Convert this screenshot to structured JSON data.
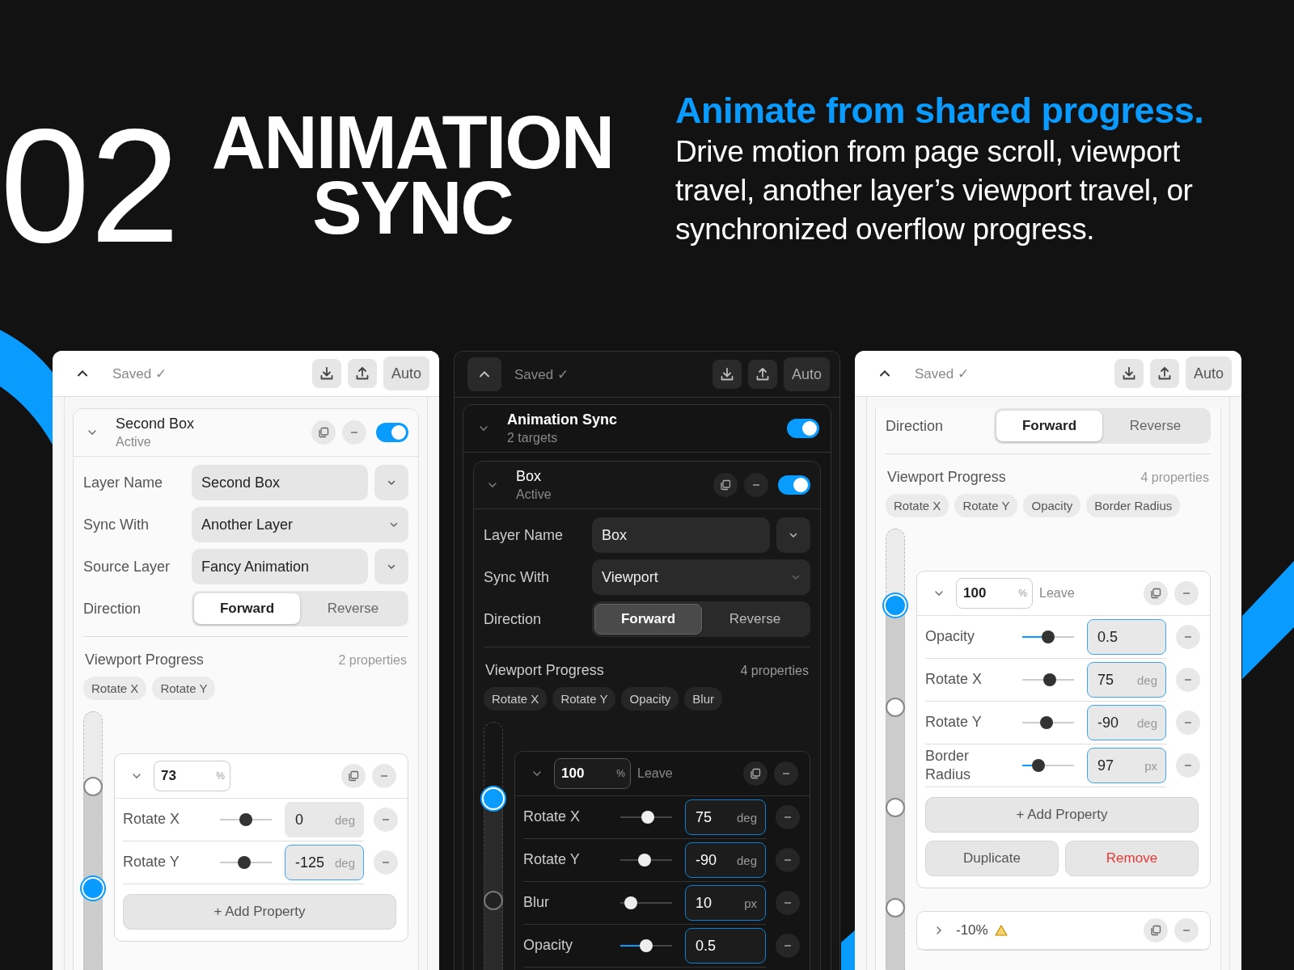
{
  "hero": {
    "number": "02",
    "title_lines": [
      "ANIMATION",
      "SYNC"
    ],
    "headline": "Animate from shared progress.",
    "description": "Drive motion from page scroll, viewport travel, another layer’s viewport travel, or synchronized overflow progress."
  },
  "panels": [
    {
      "dark": false,
      "header": {
        "status": "Saved ✓",
        "mode_button": "Auto"
      },
      "layer": {
        "title": "Second Box",
        "subtitle": "Active",
        "on": true,
        "fields": [
          {
            "label": "Layer Name",
            "value": "Second Box",
            "kind": "split"
          },
          {
            "label": "Sync With",
            "value": "Another Layer",
            "kind": "inline"
          },
          {
            "label": "Source Layer",
            "value": "Fancy Animation",
            "kind": "split"
          }
        ],
        "direction": {
          "label": "Direction",
          "options": [
            {
              "label": "Forward",
              "selected": true
            },
            {
              "label": "Reverse",
              "selected": false
            }
          ]
        },
        "progress": {
          "title": "Viewport Progress",
          "count": "2 properties",
          "chips": [
            "Rotate X",
            "Rotate Y"
          ]
        },
        "stops": [
          {
            "selected": false
          },
          {
            "selected": true
          }
        ],
        "keyframes": [
          {
            "value": "73",
            "unit": "%",
            "expanded": true,
            "rows": [
              {
                "label": "Rotate X",
                "level": 0.5,
                "filled": false,
                "value": "0",
                "unit": "deg",
                "focused": false
              },
              {
                "label": "Rotate Y",
                "level": 0.45,
                "filled": false,
                "value": "-125",
                "unit": "deg",
                "focused": true
              }
            ],
            "add_button": "+ Add Property"
          }
        ]
      }
    },
    {
      "dark": true,
      "header": {
        "status": "Saved ✓",
        "mode_button": "Auto"
      },
      "group": {
        "title": "Animation Sync",
        "subtitle": "2 targets",
        "on": true
      },
      "layer": {
        "title": "Box",
        "subtitle": "Active",
        "on": true,
        "fields": [
          {
            "label": "Layer Name",
            "value": "Box",
            "kind": "split"
          },
          {
            "label": "Sync With",
            "value": "Viewport",
            "kind": "inline"
          }
        ],
        "direction": {
          "label": "Direction",
          "options": [
            {
              "label": "Forward",
              "selected": true
            },
            {
              "label": "Reverse",
              "selected": false
            }
          ]
        },
        "progress": {
          "title": "Viewport Progress",
          "count": "4 properties",
          "chips": [
            "Rotate X",
            "Rotate Y",
            "Opacity",
            "Blur"
          ]
        },
        "stops": [
          {
            "selected": true
          },
          {
            "selected": false
          }
        ],
        "keyframes": [
          {
            "value": "100",
            "unit": "%",
            "tag": "Leave",
            "expanded": true,
            "rows": [
              {
                "label": "Rotate X",
                "level": 0.55,
                "filled": false,
                "value": "75",
                "unit": "deg",
                "focused": true
              },
              {
                "label": "Rotate Y",
                "level": 0.45,
                "filled": false,
                "value": "-90",
                "unit": "deg",
                "focused": true
              },
              {
                "label": "Blur",
                "level": 0.1,
                "filled": false,
                "value": "10",
                "unit": "px",
                "focused": true
              },
              {
                "label": "Opacity",
                "level": 0.5,
                "filled": true,
                "value": "0.5",
                "focused": true
              }
            ]
          }
        ]
      }
    },
    {
      "dark": false,
      "header": {
        "status": "Saved ✓",
        "mode_button": "Auto"
      },
      "layer": {
        "direction": {
          "label": "Direction",
          "options": [
            {
              "label": "Forward",
              "selected": true
            },
            {
              "label": "Reverse",
              "selected": false
            }
          ]
        },
        "progress": {
          "title": "Viewport Progress",
          "count": "4 properties",
          "chips": [
            "Rotate X",
            "Rotate Y",
            "Opacity",
            "Border Radius"
          ]
        },
        "stops": [
          {
            "selected": true
          },
          {
            "selected": false
          },
          {
            "selected": false
          },
          {
            "selected": false
          }
        ],
        "keyframes": [
          {
            "value": "100",
            "unit": "%",
            "tag": "Leave",
            "expanded": true,
            "rows": [
              {
                "label": "Opacity",
                "level": 0.5,
                "filled": true,
                "value": "0.5",
                "focused": true
              },
              {
                "label": "Rotate X",
                "level": 0.55,
                "filled": false,
                "value": "75",
                "unit": "deg",
                "focused": true
              },
              {
                "label": "Rotate Y",
                "level": 0.45,
                "filled": false,
                "value": "-90",
                "unit": "deg",
                "focused": true
              },
              {
                "label": "Border Radius",
                "level": 0.25,
                "filled": true,
                "value": "97",
                "unit": "px",
                "focused": true
              }
            ],
            "add_button": "+ Add Property",
            "actions": [
              {
                "label": "Duplicate",
                "kind": "neutral"
              },
              {
                "label": "Remove",
                "kind": "danger"
              }
            ]
          },
          {
            "value": "-10%",
            "expanded": false,
            "warning": true
          }
        ]
      }
    }
  ]
}
